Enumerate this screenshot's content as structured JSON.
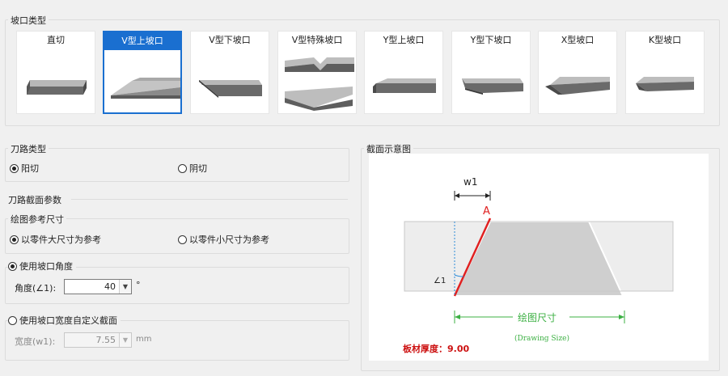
{
  "bevel_type": {
    "title": "坡口类型",
    "selected_index": 1,
    "tiles": [
      {
        "label": "直切"
      },
      {
        "label": "V型上坡口"
      },
      {
        "label": "V型下坡口"
      },
      {
        "label": "V型特殊坡口"
      },
      {
        "label": "Y型上坡口"
      },
      {
        "label": "Y型下坡口"
      },
      {
        "label": "X型坡口"
      },
      {
        "label": "K型坡口"
      }
    ]
  },
  "path_type": {
    "title": "刀路类型",
    "options": [
      {
        "label": "阳切",
        "checked": true
      },
      {
        "label": "阴切",
        "checked": false
      }
    ]
  },
  "section_params": {
    "title": "刀路截面参数",
    "drawing_ref": {
      "title": "绘图参考尺寸",
      "options": [
        {
          "label": "以零件大尺寸为参考",
          "checked": true
        },
        {
          "label": "以零件小尺寸为参考",
          "checked": false
        }
      ]
    },
    "use_angle": {
      "label": "使用坡口角度",
      "checked": true,
      "angle_label": "角度(∠1):",
      "angle_value": "40",
      "angle_unit": "°"
    },
    "use_width": {
      "label": "使用坡口宽度自定义截面",
      "checked": false,
      "width_label": "宽度(w1):",
      "width_value": "7.55",
      "width_unit": "mm"
    }
  },
  "section_diagram": {
    "title": "截面示意图",
    "w1_label": "w1",
    "point_label": "A",
    "angle_label": "∠1",
    "drawing_size_label": "绘图尺寸",
    "drawing_size_en": "(Drawing Size)",
    "thickness_label": "板材厚度：",
    "thickness_value": "9.00"
  },
  "colors": {
    "accent": "#1a6fd0",
    "red_line": "#e02020",
    "green_dim": "#3cb043",
    "dashed_blue": "#2a8ad8",
    "plate_gray": "#cfcfcf"
  }
}
